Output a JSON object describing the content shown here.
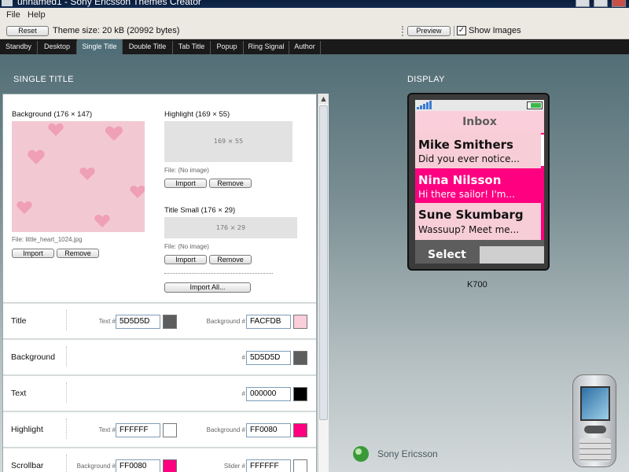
{
  "window": {
    "title": "unnamed1 - Sony Ericsson Themes Creator"
  },
  "menu": {
    "file": "File",
    "help": "Help"
  },
  "toolbar": {
    "reset": "Reset",
    "theme_size": "Theme size: 20 kB (20992 bytes)",
    "preview": "Preview",
    "show_images": "Show Images",
    "show_images_checked": true
  },
  "tabs": [
    {
      "label": "Standby"
    },
    {
      "label": "Desktop"
    },
    {
      "label": "Single Title",
      "active": true
    },
    {
      "label": "Double Title"
    },
    {
      "label": "Tab Title"
    },
    {
      "label": "Popup"
    },
    {
      "label": "Ring Signal"
    },
    {
      "label": "Author"
    }
  ],
  "section_single": "SINGLE TITLE",
  "section_display": "DISPLAY",
  "images": {
    "background": {
      "label": "Background (176 × 147)",
      "file": "File: little_heart_1024.jpg",
      "import": "Import",
      "remove": "Remove"
    },
    "highlight": {
      "label": "Highlight (169 × 55)",
      "placeholder": "169 × 55",
      "file": "File: (No image)",
      "import": "Import",
      "remove": "Remove"
    },
    "title_small": {
      "label": "Title Small (176 × 29)",
      "placeholder": "176 × 29",
      "file": "File: (No image)",
      "import": "Import",
      "remove": "Remove"
    },
    "import_all": "Import All..."
  },
  "colors": [
    {
      "label": "Title",
      "text_label": "Text #",
      "text_value": "5D5D5D",
      "text_color": "#5D5D5D",
      "bg_label": "Background #",
      "bg_value": "FACFDB",
      "bg_color": "#FACFDB"
    },
    {
      "label": "Background",
      "bg_label": "#",
      "bg_value": "5D5D5D",
      "bg_color": "#5D5D5D"
    },
    {
      "label": "Text",
      "bg_label": "#",
      "bg_value": "000000",
      "bg_color": "#000000"
    },
    {
      "label": "Highlight",
      "text_label": "Text #",
      "text_value": "FFFFFF",
      "text_color": "#FFFFFF",
      "bg_label": "Background #",
      "bg_value": "FF0080",
      "bg_color": "#FF0080"
    },
    {
      "label": "Scrollbar",
      "text_label": "Background #",
      "text_value": "FF0080",
      "text_color": "#FF0080",
      "bg_label": "Slider #",
      "bg_value": "FFFFFF",
      "bg_color": "#FFFFFF"
    }
  ],
  "phone": {
    "model": "K700",
    "title": "Inbox",
    "messages": [
      {
        "name": "Mike Smithers",
        "text": "Did you ever notice...",
        "highlighted": false
      },
      {
        "name": "Nina Nilsson",
        "text": "Hi there sailor! I'm...",
        "highlighted": true
      },
      {
        "name": "Sune Skumbarg",
        "text": "Wassuup?  Meet me...",
        "highlighted": false
      }
    ],
    "softkey": "Select",
    "bg_color": "#F7CDD8",
    "highlight_color": "#FF0080"
  },
  "brand": "Sony Ericsson"
}
